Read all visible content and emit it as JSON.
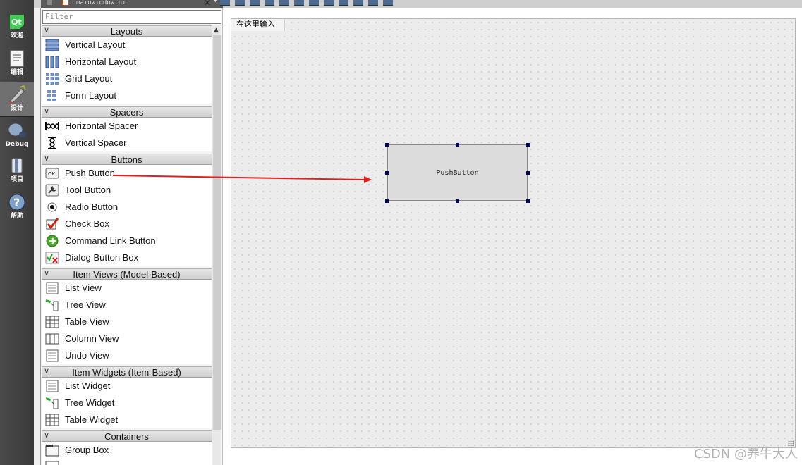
{
  "window": {
    "file_tab": "mainwindow.ui",
    "close_symbol": "×",
    "dropdown_symbol": "▾"
  },
  "modebar": {
    "items": [
      {
        "label": "欢迎",
        "icon": "qt-logo-icon"
      },
      {
        "label": "编辑",
        "icon": "document-edit-icon"
      },
      {
        "label": "设计",
        "icon": "design-pen-icon",
        "active": true
      },
      {
        "label": "Debug",
        "icon": "debug-bug-icon"
      },
      {
        "label": "项目",
        "icon": "project-wrench-icon"
      },
      {
        "label": "帮助",
        "icon": "help-question-icon"
      }
    ]
  },
  "widgetbox": {
    "filter_placeholder": "Filter",
    "categories": [
      {
        "label": "Layouts",
        "items": [
          "Vertical Layout",
          "Horizontal Layout",
          "Grid Layout",
          "Form Layout"
        ]
      },
      {
        "label": "Spacers",
        "items": [
          "Horizontal Spacer",
          "Vertical Spacer"
        ]
      },
      {
        "label": "Buttons",
        "items": [
          "Push Button",
          "Tool Button",
          "Radio Button",
          "Check Box",
          "Command Link Button",
          "Dialog Button Box"
        ]
      },
      {
        "label": "Item Views (Model-Based)",
        "items": [
          "List View",
          "Tree View",
          "Table View",
          "Column View",
          "Undo View"
        ]
      },
      {
        "label": "Item Widgets (Item-Based)",
        "items": [
          "List Widget",
          "Tree Widget",
          "Table Widget"
        ]
      },
      {
        "label": "Containers",
        "items": [
          "Group Box"
        ]
      }
    ]
  },
  "form": {
    "menubar_placeholder": "在这里输入",
    "push_button_text": "PushButton"
  },
  "colors": {
    "arrow": "#e02020",
    "handle": "#00005a",
    "modebar": "#404040"
  },
  "watermark": "CSDN @养牛大人"
}
